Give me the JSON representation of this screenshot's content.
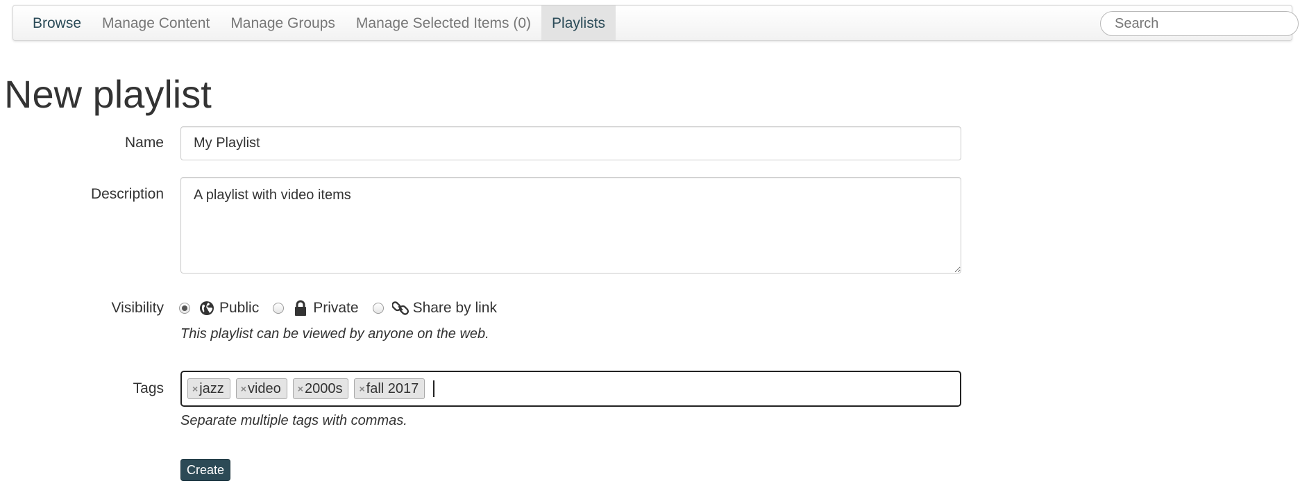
{
  "nav": {
    "items": [
      {
        "label": "Browse"
      },
      {
        "label": "Manage Content"
      },
      {
        "label": "Manage Groups"
      },
      {
        "label": "Manage Selected Items (0)"
      },
      {
        "label": "Playlists",
        "active": true
      }
    ],
    "search_placeholder": "Search"
  },
  "page": {
    "title": "New playlist"
  },
  "form": {
    "name_label": "Name",
    "name_value": "My Playlist",
    "description_label": "Description",
    "description_value": "A playlist with video items",
    "visibility_label": "Visibility",
    "visibility_options": [
      {
        "label": "Public",
        "icon": "globe-icon",
        "checked": true
      },
      {
        "label": "Private",
        "icon": "lock-icon",
        "checked": false
      },
      {
        "label": "Share by link",
        "icon": "link-icon",
        "checked": false
      }
    ],
    "visibility_help": "This playlist can be viewed by anyone on the web.",
    "tags_label": "Tags",
    "tags": [
      "jazz",
      "video",
      "2000s",
      "fall 2017"
    ],
    "tag_remove_glyph": "×",
    "tags_help": "Separate multiple tags with commas.",
    "submit_label": "Create"
  },
  "colors": {
    "brand": "#2c4a56",
    "nav_active_bg": "#e3e3e3"
  }
}
